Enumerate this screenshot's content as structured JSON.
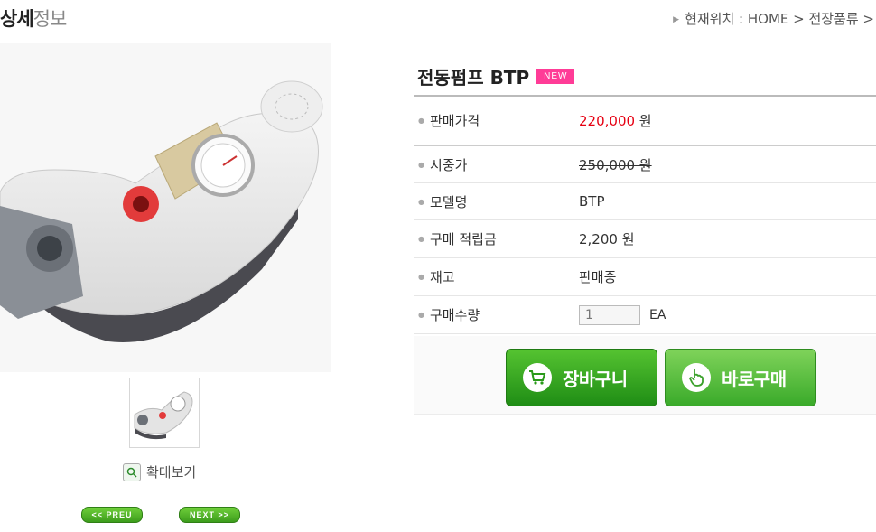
{
  "header": {
    "title_bold": "상세",
    "title_light": "정보",
    "breadcrumb": "현재위치 : HOME > 전장품류 >"
  },
  "gallery": {
    "main_image_icon": "air-pump-product-photo",
    "thumbnail_icon": "air-pump-thumbnail",
    "zoom_label": "확대보기",
    "prev_label": "<< PREU",
    "next_label": "NEXT >>"
  },
  "product": {
    "name": "전동펌프 BTP",
    "badge": "NEW",
    "rows": [
      {
        "label": "판매가격",
        "value_num": "220,000",
        "value_unit": " 원"
      },
      {
        "label": "시중가",
        "value": "250,000 원"
      },
      {
        "label": "모델명",
        "value": "BTP"
      },
      {
        "label": "구매 적립금",
        "value": "2,200 원"
      },
      {
        "label": "재고",
        "value": "판매중"
      },
      {
        "label": "구매수량",
        "qty_value": "1",
        "qty_unit": "EA"
      }
    ],
    "cart_label": "장바구니",
    "buy_label": "바로구매"
  },
  "colors": {
    "price_red": "#e60012",
    "badge_pink": "#ff3c97",
    "button_green": "#2fa11f"
  }
}
